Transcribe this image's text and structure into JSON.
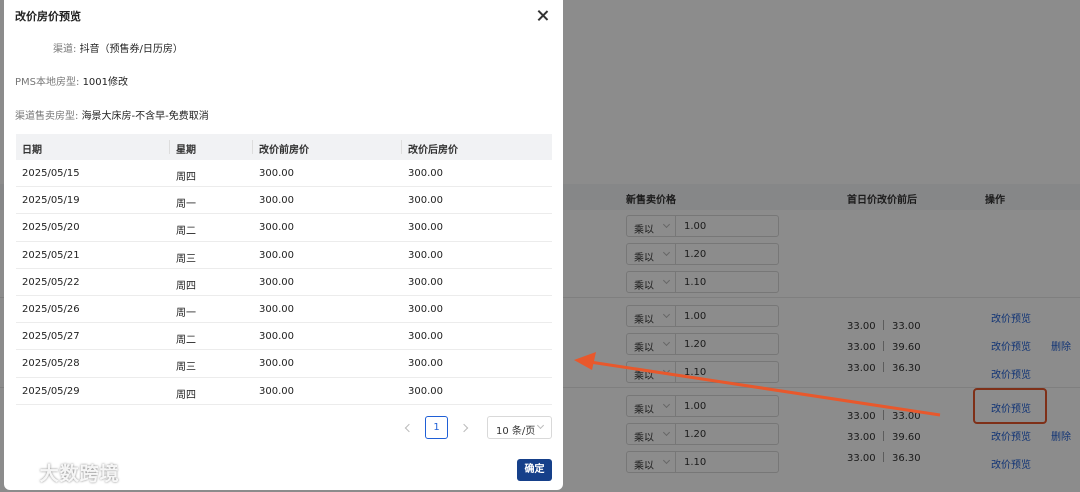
{
  "modal": {
    "title": "改价房价预览",
    "channel_label": "渠道:",
    "channel_value": "抖音（预售券/日历房）",
    "pms_room_label": "PMS本地房型:",
    "pms_room_value": "1001修改",
    "sale_room_label": "渠道售卖房型:",
    "sale_room_value": "海景大床房-不含早-免费取消",
    "table": {
      "headers": [
        "日期",
        "星期",
        "改价前房价",
        "改价后房价"
      ],
      "rows": [
        [
          "2025/05/15",
          "周四",
          "300.00",
          "300.00"
        ],
        [
          "2025/05/19",
          "周一",
          "300.00",
          "300.00"
        ],
        [
          "2025/05/20",
          "周二",
          "300.00",
          "300.00"
        ],
        [
          "2025/05/21",
          "周三",
          "300.00",
          "300.00"
        ],
        [
          "2025/05/22",
          "周四",
          "300.00",
          "300.00"
        ],
        [
          "2025/05/26",
          "周一",
          "300.00",
          "300.00"
        ],
        [
          "2025/05/27",
          "周二",
          "300.00",
          "300.00"
        ],
        [
          "2025/05/28",
          "周三",
          "300.00",
          "300.00"
        ],
        [
          "2025/05/29",
          "周四",
          "300.00",
          "300.00"
        ]
      ]
    },
    "pagination": {
      "current_page": "1",
      "page_size": "10 条/页"
    },
    "confirm_label": "确定"
  },
  "background": {
    "headers": {
      "new_price": "新售卖价格",
      "first_day": "首日价改价前后",
      "action": "操作"
    },
    "multiplier_label": "乘以",
    "groups": [
      {
        "values": [
          "1.00",
          "1.20",
          "1.10"
        ],
        "prices": []
      },
      {
        "values": [
          "1.00",
          "1.20",
          "1.10"
        ],
        "prices": [
          "33.00 ｜ 33.00",
          "33.00 ｜ 39.60",
          "33.00 ｜ 36.30"
        ]
      },
      {
        "values": [
          "1.00",
          "1.20",
          "1.10"
        ],
        "prices": [
          "33.00 ｜ 33.00",
          "33.00 ｜ 39.60",
          "33.00 ｜ 36.30"
        ]
      }
    ],
    "preview_link": "改价预览",
    "delete_link": "删除"
  },
  "watermark": {
    "text": "大数跨境"
  },
  "colors": {
    "primary": "#16408a",
    "link": "#1f5fd6",
    "annotation": "#e8582c"
  }
}
